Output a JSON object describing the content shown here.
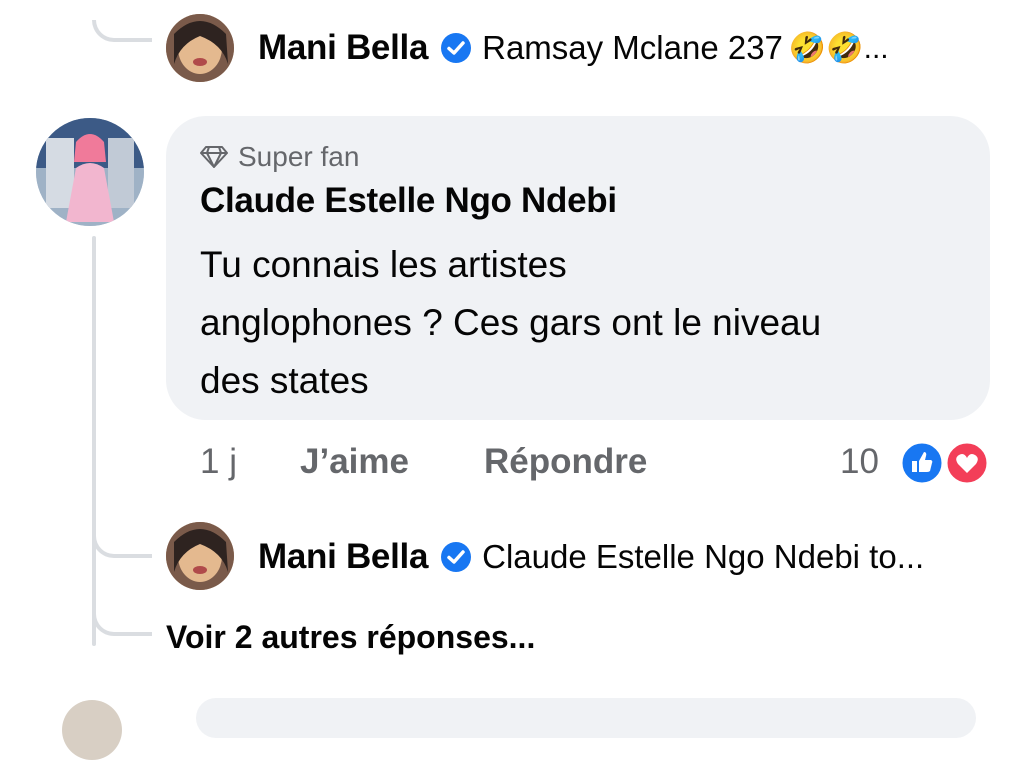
{
  "reply_1": {
    "author": "Mani Bella",
    "text": "Ramsay Mclane 237",
    "emoji": "🤣🤣...",
    "avatar_icon": "avatar-photo"
  },
  "comment": {
    "badge": "Super fan",
    "badge_icon": "diamond-icon",
    "author": "Claude Estelle Ngo Ndebi",
    "lines": [
      "Tu connais les artistes",
      "anglophones ? Ces gars ont le niveau",
      "des states"
    ],
    "time": "1 j",
    "like_label": "J’aime",
    "reply_label": "Répondre",
    "reaction_count": "10",
    "reactions": [
      "like-icon",
      "love-icon"
    ]
  },
  "reply_2": {
    "author": "Mani Bella",
    "text": "Claude Estelle Ngo Ndebi to..."
  },
  "more_replies": "Voir 2 autres réponses...",
  "colors": {
    "bubble": "#f0f2f5",
    "meta": "#65676b",
    "like": "#1877f2",
    "love": "#f33e58",
    "thread_line": "#dadde1"
  }
}
